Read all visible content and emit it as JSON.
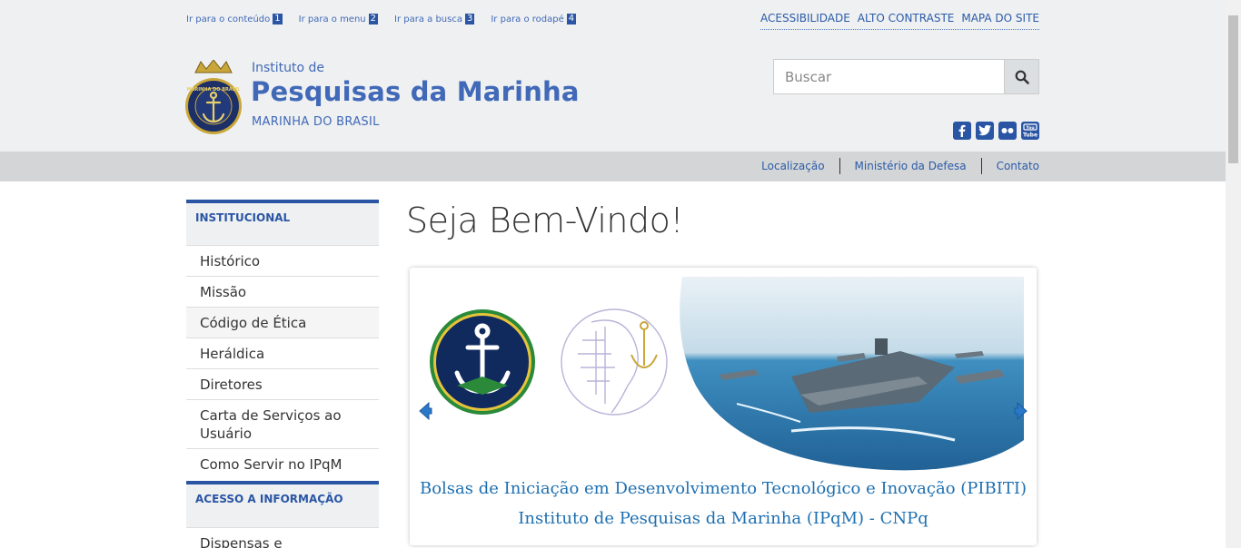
{
  "skiplinks": [
    {
      "label": "Ir para o conteúdo",
      "num": "1"
    },
    {
      "label": "Ir para o menu",
      "num": "2"
    },
    {
      "label": "Ir para a busca",
      "num": "3"
    },
    {
      "label": "Ir para o rodapé",
      "num": "4"
    }
  ],
  "toplinks": [
    "ACESSIBILIDADE",
    "ALTO CONTRASTE",
    "MAPA DO SITE"
  ],
  "brand": {
    "pre": "Instituto de",
    "title": "Pesquisas da Marinha",
    "sub": "MARINHA DO BRASIL",
    "logo_text": "MARINHA DO BRASIL"
  },
  "search": {
    "placeholder": "Buscar",
    "value": ""
  },
  "social": [
    "facebook-icon",
    "twitter-icon",
    "flickr-icon",
    "youtube-icon"
  ],
  "subnav": [
    "Localização",
    "Ministério da Defesa",
    "Contato"
  ],
  "sidebar": {
    "sections": [
      {
        "title": "INSTITUCIONAL",
        "items": [
          "Histórico",
          "Missão",
          "Código de Ética",
          "Heráldica",
          "Diretores",
          "Carta de Serviços ao Usuário",
          "Como Servir no IPqM"
        ]
      },
      {
        "title": "ACESSO A INFORMAÇÃO",
        "items": [
          "Dispensas e"
        ]
      }
    ]
  },
  "main": {
    "welcome": "Seja Bem-Vindo!",
    "slide": {
      "caption_line1": "Bolsas de Iniciação em Desenvolvimento Tecnológico e Inovação (PIBITI)",
      "caption_line2": "Instituto de Pesquisas da Marinha (IPqM) - CNPq"
    }
  },
  "colors": {
    "brand_blue": "#4169b8",
    "link_blue": "#2b5ba9",
    "accent_bar": "#2a55a5",
    "caption_blue": "#1d6fb0"
  }
}
